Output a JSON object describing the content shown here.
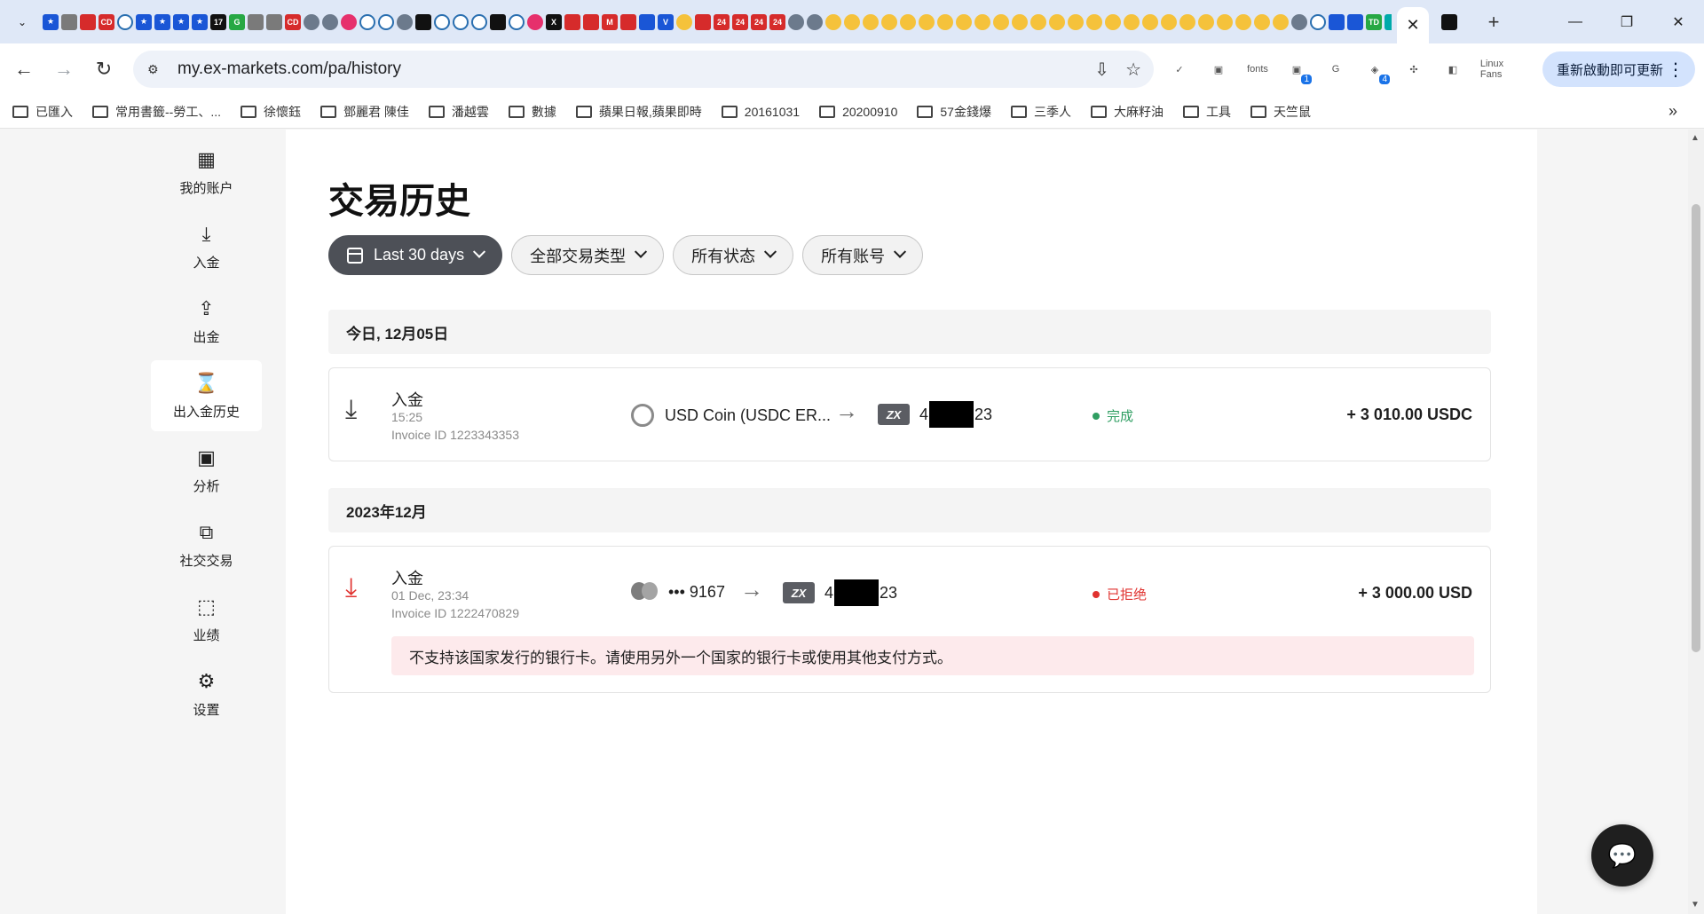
{
  "browser": {
    "url": "my.ex-markets.com/pa/history",
    "restart_label": "重新啟動即可更新",
    "fonts_ext_label": "fonts",
    "linux_ext_label": "Linux Fans",
    "ext_badge_1": "1",
    "ext_badge_2": "4",
    "bookmarks": [
      "已匯入",
      "常用書籤--勞工、...",
      "徐懷鈺",
      "鄧麗君 陳佳",
      "潘越雲",
      "數據",
      "蘋果日報,蘋果即時",
      "20161031",
      "20200910",
      "57金錢爆",
      "三季人",
      "大麻籽油",
      "工具",
      "天竺鼠"
    ]
  },
  "sidebar": {
    "items": [
      {
        "label": "我的账户",
        "icon": "grid-icon"
      },
      {
        "label": "入金",
        "icon": "download-icon"
      },
      {
        "label": "出金",
        "icon": "upload-icon"
      },
      {
        "label": "出入金历史",
        "icon": "hourglass-icon"
      },
      {
        "label": "分析",
        "icon": "chart-bubble-icon"
      },
      {
        "label": "社交交易",
        "icon": "copy-trade-icon"
      },
      {
        "label": "业绩",
        "icon": "performance-icon"
      },
      {
        "label": "设置",
        "icon": "gear-icon"
      }
    ]
  },
  "page": {
    "title": "交易历史",
    "filters": {
      "date": "Last 30 days",
      "type": "全部交易类型",
      "status": "所有状态",
      "account": "所有账号"
    },
    "groups": [
      {
        "heading": "今日, 12月05日",
        "txn": {
          "type": "入金",
          "time": "15:25",
          "invoice": "Invoice ID 1223343353",
          "source": "USD Coin (USDC ER...",
          "account_prefix": "4",
          "account_suffix": "23",
          "status": "完成",
          "amount": "+ 3 010.00 USDC"
        }
      },
      {
        "heading": "2023年12月",
        "txn": {
          "type": "入金",
          "time": "01 Dec, 23:34",
          "invoice": "Invoice ID 1222470829",
          "source": "••• 9167",
          "account_prefix": "4",
          "account_suffix": "23",
          "status": "已拒绝",
          "amount": "+ 3 000.00 USD",
          "error": "不支持该国家发行的银行卡。请使用另外一个国家的银行卡或使用其他支付方式。"
        }
      }
    ]
  },
  "colors": {
    "accent_yellow": "#f5c400",
    "status_ok": "#2f9e62",
    "status_rejected": "#e0322f",
    "error_bg": "#fdeaec"
  }
}
